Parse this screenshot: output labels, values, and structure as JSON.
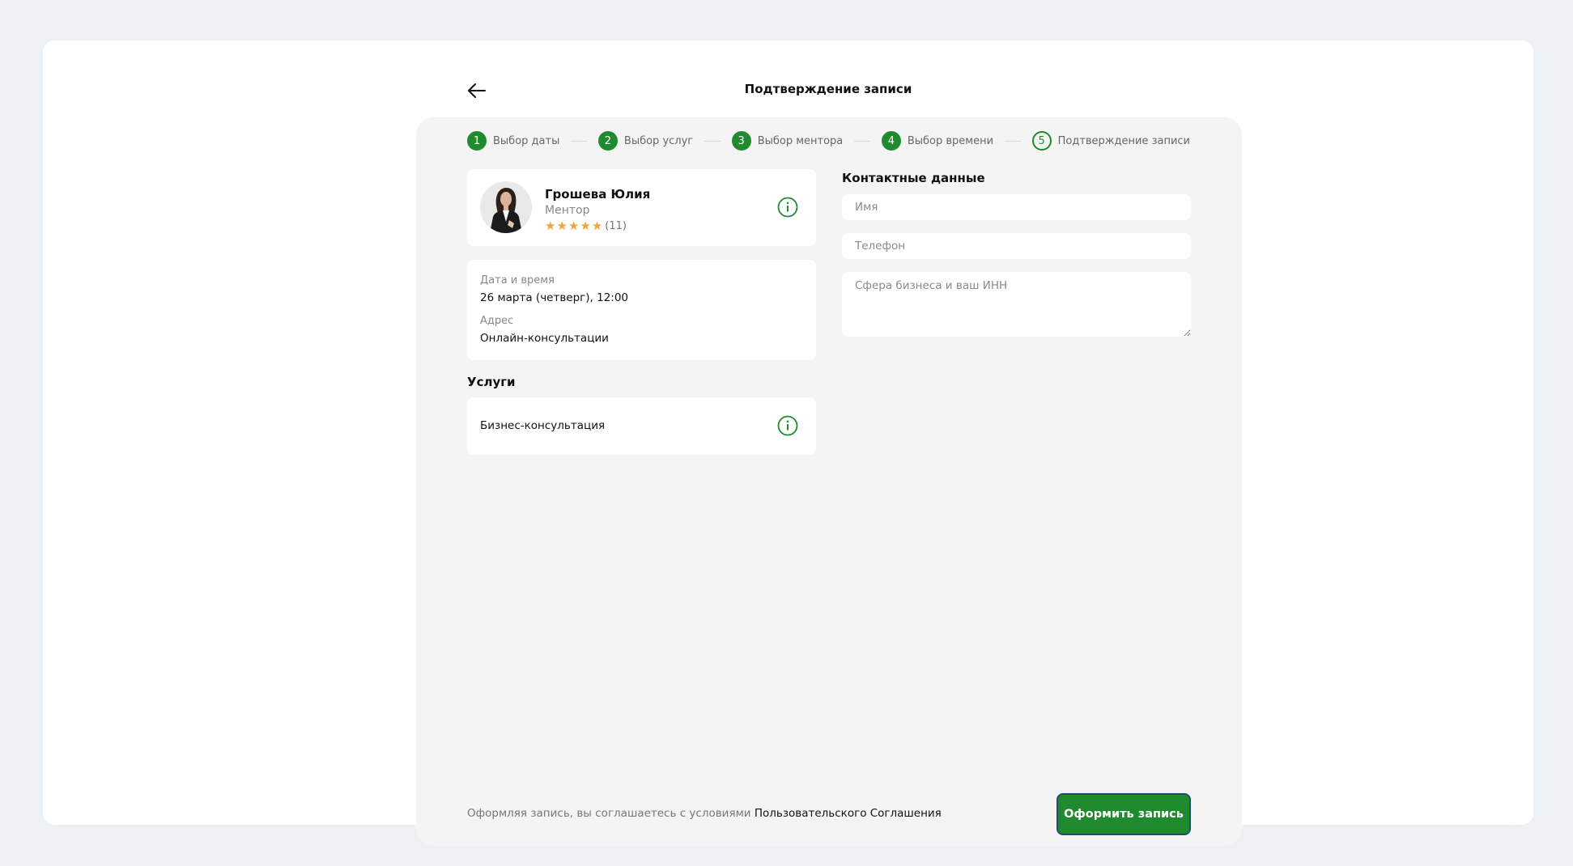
{
  "header": {
    "title": "Подтверждение записи"
  },
  "stepper": {
    "steps": [
      {
        "number": "1",
        "label": "Выбор даты"
      },
      {
        "number": "2",
        "label": "Выбор услуг"
      },
      {
        "number": "3",
        "label": "Выбор ментора"
      },
      {
        "number": "4",
        "label": "Выбор времени"
      },
      {
        "number": "5",
        "label": "Подтверждение записи"
      }
    ]
  },
  "mentor": {
    "name": "Грошева Юлия",
    "role": "Ментор",
    "rating_stars": 5,
    "reviews_count": "(11)"
  },
  "details": {
    "datetime_label": "Дата и время",
    "datetime_value": "26 марта (четверг), 12:00",
    "address_label": "Адрес",
    "address_value": "Онлайн-консультации"
  },
  "services": {
    "title": "Услуги",
    "items": [
      {
        "name": "Бизнес-консультация"
      }
    ]
  },
  "contacts": {
    "title": "Контактные данные",
    "name_placeholder": "Имя",
    "phone_placeholder": "Телефон",
    "business_placeholder": "Сфера бизнеса и ваш ИНН"
  },
  "footer": {
    "agreement_text": "Оформляя запись, вы соглашаетесь с условиями",
    "agreement_link": "Пользовательского Соглашения",
    "submit_label": "Оформить запись"
  },
  "colors": {
    "accent": "#1f8a2e",
    "star": "#f2a53a",
    "panel": "#f4f4f4",
    "page_bg": "#eef1f4"
  }
}
